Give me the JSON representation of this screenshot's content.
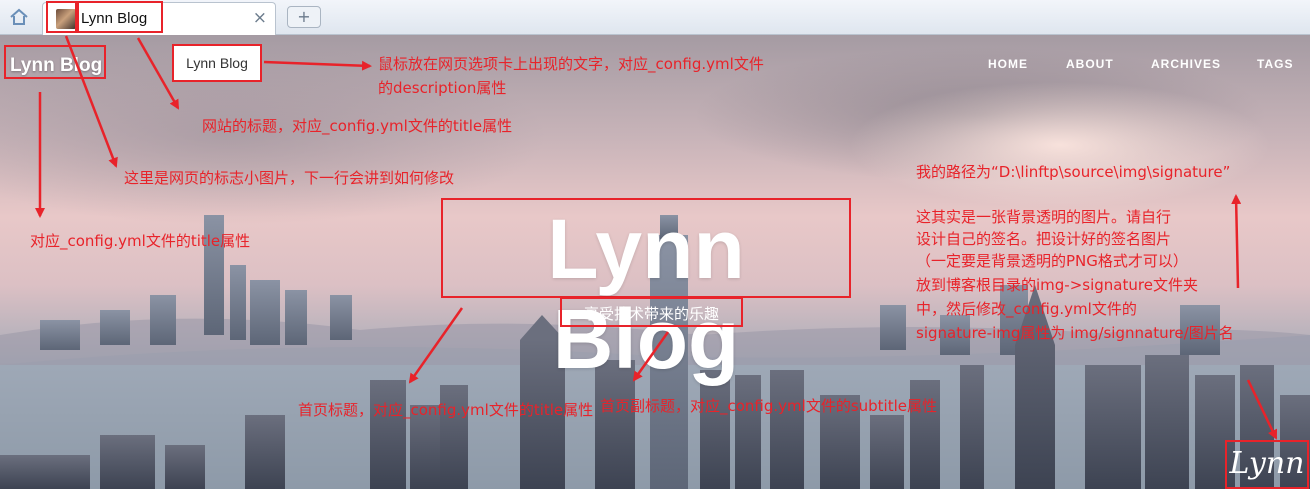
{
  "browser": {
    "tab_title": "Lynn Blog",
    "close_glyph": "×",
    "new_tab_glyph": "+",
    "tooltip": "Lynn Blog"
  },
  "header": {
    "site_title": "Lynn Blog",
    "nav": [
      {
        "label": "HOME"
      },
      {
        "label": "ABOUT"
      },
      {
        "label": "ARCHIVES"
      },
      {
        "label": "TAGS"
      }
    ]
  },
  "hero": {
    "title": "Lynn Blog",
    "subtitle": "享受技术带来的乐趣",
    "signature": "Lynn"
  },
  "annotations": {
    "tooltip_note_1": "鼠标放在网页选项卡上出现的文字，对应_config.yml文件",
    "tooltip_note_2": "的description属性",
    "tab_title_note": "网站的标题，对应_config.yml文件的title属性",
    "favicon_note": "这里是网页的标志小图片，下一行会讲到如何修改",
    "site_title_note": "对应_config.yml文件的title属性",
    "hero_title_note": "首页标题，对应_config.yml文件的title属性",
    "subtitle_note": "首页副标题，对应_config.yml文件的subtitle属性",
    "path_note": "我的路径为“D:\\linftp\\source\\img\\signature”",
    "signature_note": [
      "这其实是一张背景透明的图片。请自行",
      "设计自己的签名。把设计好的签名图片",
      "（一定要是背景透明的PNG格式才可以）",
      "放到博客根目录的img->signature文件夹",
      "中，然后修改_config.yml文件的",
      "signature-img属性为 img/signnature/图片名"
    ]
  },
  "colors": {
    "annotation_red": "#e8232a",
    "nav_text": "#ffffff"
  },
  "icons": [
    "home-icon",
    "favicon-image",
    "close-icon",
    "plus-icon"
  ]
}
